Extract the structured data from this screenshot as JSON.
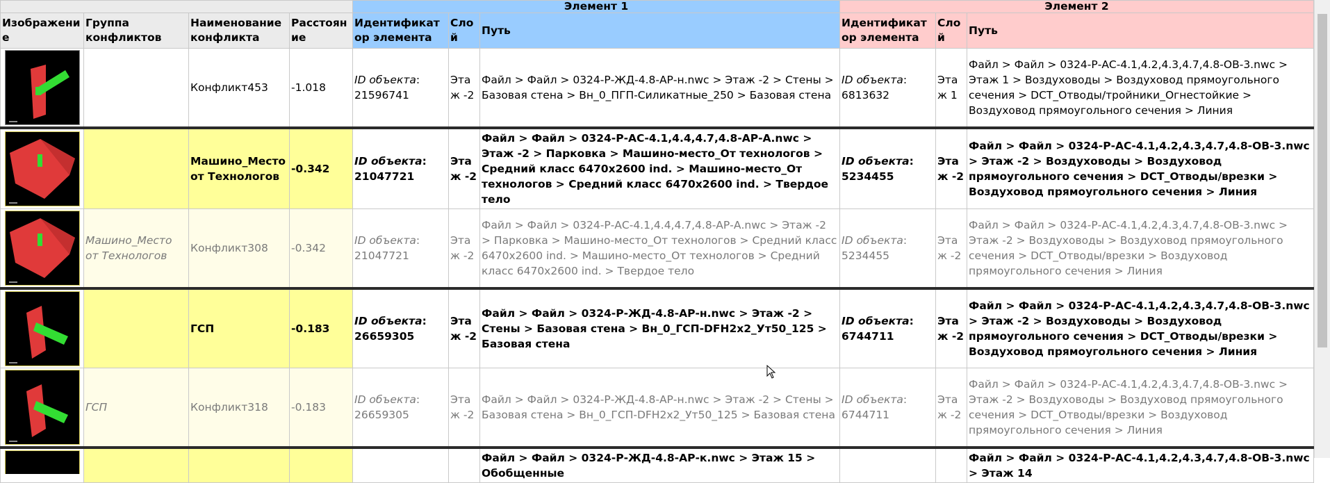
{
  "group_headers": {
    "element1": "Элемент 1",
    "element2": "Элемент 2"
  },
  "columns": {
    "image": "Изображение",
    "group": "Группа конфликтов",
    "name": "Наименование конфликта",
    "distance": "Расстояние",
    "e1_id": "Идентификатор элемента",
    "e1_layer": "Слой",
    "e1_path": "Путь",
    "e2_id": "Идентификатор элемента",
    "e2_layer": "Слой",
    "e2_path": "Путь"
  },
  "id_label": "ID объекта",
  "rows": [
    {
      "group": "",
      "name": "Конфликт453",
      "distance": "-1.018",
      "e1_id": "21596741",
      "e1_layer": "Этаж -2",
      "e1_path": "Файл > Файл > 0324-Р-ЖД-4.8-АР-н.nwc > Этаж -2 > Стены > Базовая стена > Вн_0_ПГП-Силикатные_250 > Базовая стена",
      "e2_id": "6813632",
      "e2_layer": "Этаж 1",
      "e2_path": "Файл > Файл > 0324-Р-АС-4.1,4.2,4.3,4.7,4.8-ОВ-3.nwc > Этаж 1 > Воздуховоды > Воздуховод прямоугольного сечения > DCT_Отводы/тройники_Огнестойкие > Воздуховод прямоугольного сечения > Линия"
    },
    {
      "group": "",
      "name": "Машино_Место от Технологов",
      "distance": "-0.342",
      "e1_id": "21047721",
      "e1_layer": "Этаж -2",
      "e1_path": "Файл > Файл > 0324-Р-АС-4.1,4.4,4.7,4.8-АР-А.nwc > Этаж -2 > Парковка > Машино-место_От технологов > Средний класс 6470x2600 ind. > Машино-место_От технологов > Средний класс 6470x2600 ind. > Твердое тело",
      "e2_id": "5234455",
      "e2_layer": "Этаж -2",
      "e2_path": "Файл > Файл > 0324-Р-АС-4.1,4.2,4.3,4.7,4.8-ОВ-3.nwc > Этаж -2 > Воздуховоды > Воздуховод прямоугольного сечения > DCT_Отводы/врезки > Воздуховод прямоугольного сечения > Линия"
    },
    {
      "group": "Машино_Место от Технологов",
      "name": "Конфликт308",
      "distance": "-0.342",
      "e1_id": "21047721",
      "e1_layer": "Этаж -2",
      "e1_path": "Файл > Файл > 0324-Р-АС-4.1,4.4,4.7,4.8-АР-А.nwc > Этаж -2 > Парковка > Машино-место_От технологов > Средний класс 6470x2600 ind. > Машино-место_От технологов > Средний класс 6470x2600 ind. > Твердое тело",
      "e2_id": "5234455",
      "e2_layer": "Этаж -2",
      "e2_path": "Файл > Файл > 0324-Р-АС-4.1,4.2,4.3,4.7,4.8-ОВ-3.nwc > Этаж -2 > Воздуховоды > Воздуховод прямоугольного сечения > DCT_Отводы/врезки > Воздуховод прямоугольного сечения > Линия"
    },
    {
      "group": "",
      "name": "ГСП",
      "distance": "-0.183",
      "e1_id": "26659305",
      "e1_layer": "Этаж -2",
      "e1_path": "Файл > Файл > 0324-Р-ЖД-4.8-АР-н.nwc > Этаж -2 > Стены > Базовая стена > Вн_0_ГСП-DFH2x2_Ут50_125 > Базовая стена",
      "e2_id": "6744711",
      "e2_layer": "Этаж -2",
      "e2_path": "Файл > Файл > 0324-Р-АС-4.1,4.2,4.3,4.7,4.8-ОВ-3.nwc > Этаж -2 > Воздуховоды > Воздуховод прямоугольного сечения > DCT_Отводы/врезки > Воздуховод прямоугольного сечения > Линия"
    },
    {
      "group": "ГСП",
      "name": "Конфликт318",
      "distance": "-0.183",
      "e1_id": "26659305",
      "e1_layer": "Этаж -2",
      "e1_path": "Файл > Файл > 0324-Р-ЖД-4.8-АР-н.nwc > Этаж -2 > Стены > Базовая стена > Вн_0_ГСП-DFH2x2_Ут50_125 > Базовая стена",
      "e2_id": "6744711",
      "e2_layer": "Этаж -2",
      "e2_path": "Файл > Файл > 0324-Р-АС-4.1,4.2,4.3,4.7,4.8-ОВ-3.nwc > Этаж -2 > Воздуховоды > Воздуховод прямоугольного сечения > DCT_Отводы/врезки > Воздуховод прямоугольного сечения > Линия"
    },
    {
      "e1_path": "Файл > Файл > 0324-Р-ЖД-4.8-АР-к.nwc > Этаж 15 > Обобщенные",
      "e2_path": "Файл > Файл > 0324-Р-АС-4.1,4.2,4.3,4.7,4.8-ОВ-3.nwc > Этаж 14"
    }
  ],
  "colors": {
    "header_gray": "#ebebeb",
    "element1_blue": "#99ccff",
    "element2_pink": "#ffcccc",
    "group_yellow": "#ffff99",
    "child_yellow": "#fffde8",
    "clash_red": "#e03a3a",
    "clash_green": "#33dd33"
  },
  "icons": [
    "wall-clash-thumbnail",
    "parking-clash-thumbnail",
    "mouse-cursor-icon"
  ]
}
